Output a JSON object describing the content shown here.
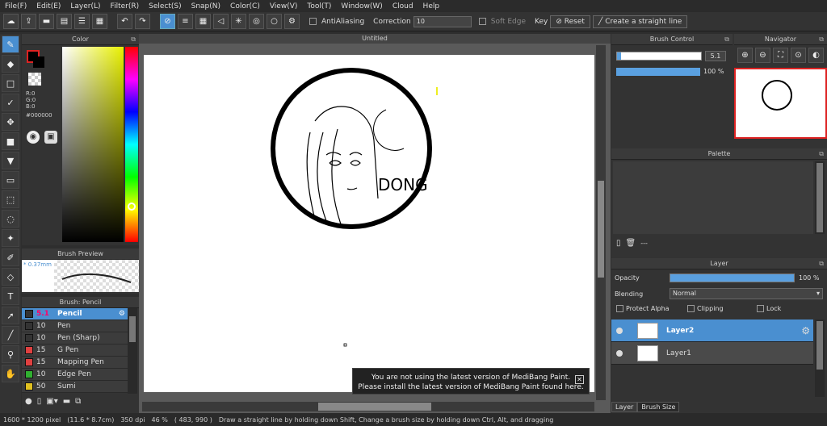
{
  "menu": [
    "File(F)",
    "Edit(E)",
    "Layer(L)",
    "Filter(R)",
    "Select(S)",
    "Snap(N)",
    "Color(C)",
    "View(V)",
    "Tool(T)",
    "Window(W)",
    "Cloud",
    "Help"
  ],
  "toolbar": {
    "antialiasing_label": "AntiAliasing",
    "correction_label": "Correction",
    "correction_value": "10",
    "soft_edge_label": "Soft Edge",
    "key_label": "Key",
    "reset_label": "Reset",
    "straight_line_label": "Create a straight line"
  },
  "color_panel": {
    "title": "Color",
    "r": "R:0",
    "g": "G:0",
    "b": "B:0",
    "hex": "#000000"
  },
  "brush_preview": {
    "title": "Brush Preview",
    "size": "* 0.37mm"
  },
  "brush_list": {
    "title": "Brush: Pencil",
    "items": [
      {
        "size": "5.1",
        "name": "Pencil",
        "color": "#333333"
      },
      {
        "size": "10",
        "name": "Pen",
        "color": "#333333"
      },
      {
        "size": "10",
        "name": "Pen (Sharp)",
        "color": "#333333"
      },
      {
        "size": "15",
        "name": "G Pen",
        "color": "#e04040"
      },
      {
        "size": "15",
        "name": "Mapping Pen",
        "color": "#e04040"
      },
      {
        "size": "10",
        "name": "Edge Pen",
        "color": "#30b030"
      },
      {
        "size": "50",
        "name": "Sumi",
        "color": "#e0c020"
      }
    ]
  },
  "canvas": {
    "tab": "Untitled",
    "drawing_text": "DONG"
  },
  "brush_control": {
    "title": "Brush Control",
    "size_value": "5.1",
    "opacity_value": "100 %",
    "size_fraction": 0.05,
    "opacity_fraction": 1.0
  },
  "navigator": {
    "title": "Navigator"
  },
  "palette": {
    "title": "Palette",
    "dashes": "---"
  },
  "layer_panel": {
    "title": "Layer",
    "opacity_label": "Opacity",
    "opacity_value": "100 %",
    "blending_label": "Blending",
    "blending_value": "Normal",
    "protect_alpha": "Protect Alpha",
    "clipping": "Clipping",
    "lock": "Lock",
    "layers": [
      {
        "name": "Layer2",
        "selected": true
      },
      {
        "name": "Layer1",
        "selected": false
      }
    ],
    "tab_layer": "Layer",
    "tab_brush_size": "Brush Size"
  },
  "notice": {
    "line1": "You are not using the latest version of MediBang Paint.",
    "line2": "Please install the latest version of MediBang Paint found here."
  },
  "status": {
    "size": "1600 * 1200 pixel",
    "phys": "(11.6 * 8.7cm)",
    "dpi": "350 dpi",
    "zoom": "46 %",
    "coords": "( 483, 990 )",
    "hint": "Draw a straight line by holding down Shift, Change a brush size by holding down Ctrl, Alt, and dragging"
  }
}
